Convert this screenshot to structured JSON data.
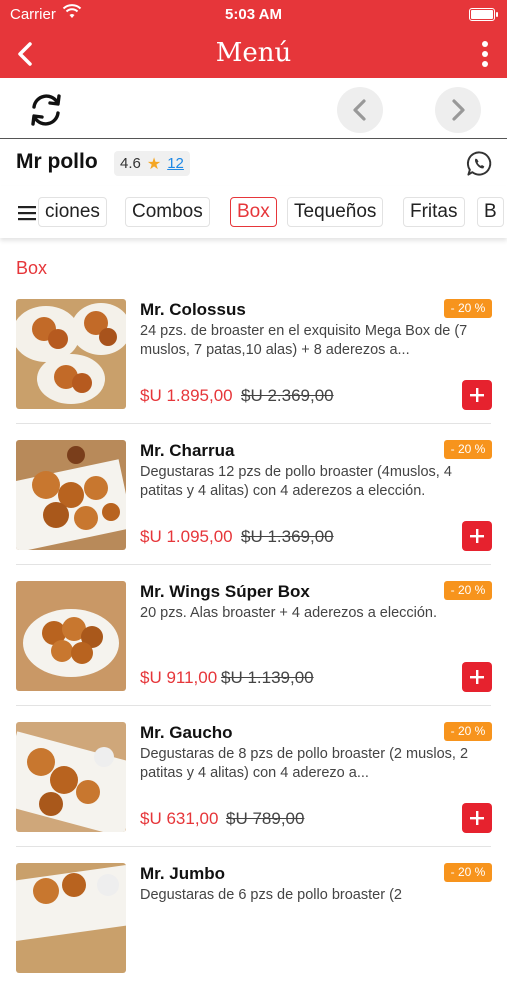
{
  "status": {
    "carrier": "Carrier",
    "time": "5:03 AM"
  },
  "nav": {
    "title": "Menú"
  },
  "store": {
    "name": "Mr pollo",
    "rating": "4.6",
    "reviews": "12"
  },
  "tabs": [
    "ciones",
    "Combos",
    "Box",
    "Tequeños",
    "Fritas",
    "B"
  ],
  "active_tab": "Box",
  "section": {
    "title": "Box"
  },
  "items": [
    {
      "name": "Mr. Colossus",
      "discount": "- 20 %",
      "description": "24 pzs. de broaster en el exquisito Mega Box de (7 muslos, 7 patas,10 alas) + 8 aderezos a...",
      "price": "$U 1.895,00",
      "old_price": "$U 2.369,00"
    },
    {
      "name": "Mr. Charrua",
      "discount": "- 20 %",
      "description": "Degustaras 12 pzs de pollo broaster (4muslos, 4 patitas y 4 alitas) con 4 aderezos a elección.",
      "price": "$U 1.095,00",
      "old_price": "$U 1.369,00"
    },
    {
      "name": "Mr. Wings Súper Box",
      "discount": "- 20 %",
      "description": "20 pzs. Alas broaster + 4 aderezos a elección.",
      "price": "$U 911,00",
      "old_price": "$U 1.139,00"
    },
    {
      "name": "Mr. Gaucho",
      "discount": "- 20 %",
      "description": "Degustaras de 8 pzs de pollo broaster (2 muslos, 2 patitas y 4 alitas) con 4 aderezo a...",
      "price": "$U 631,00",
      "old_price": "$U 789,00"
    },
    {
      "name": "Mr. Jumbo",
      "discount": "- 20 %",
      "description": "Degustaras de 6 pzs de pollo broaster (2",
      "price": "",
      "old_price": ""
    }
  ],
  "colors": {
    "brand_red": "#e6363a",
    "discount_orange": "#f7941d",
    "link_blue": "#1e88e5",
    "star": "#f5a623"
  },
  "icons": {
    "back": "chevron-left-icon",
    "more": "more-vertical-icon",
    "refresh": "refresh-icon",
    "prev": "chevron-left-icon",
    "next": "chevron-right-icon",
    "whatsapp": "whatsapp-icon",
    "menu": "hamburger-icon",
    "add": "plus-icon"
  }
}
